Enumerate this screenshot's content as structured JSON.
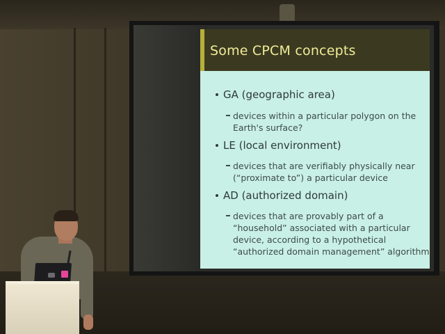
{
  "slide": {
    "title": "Some CPCM concepts",
    "colors": {
      "header_bg": "#3b3a20",
      "title_text": "#f0ec9a",
      "body_bg": "#c9f0e6",
      "body_text": "#2d3a38"
    },
    "bullets": [
      {
        "text": "GA (geographic area)",
        "sub": [
          "devices within a particular polygon on the",
          "Earth's surface?"
        ]
      },
      {
        "text": "LE (local environment)",
        "sub": [
          "devices that are verifiably physically near",
          "(“proximate to”) a particular device"
        ]
      },
      {
        "text": "AD (authorized domain)",
        "sub": [
          "devices that are provably part of a",
          "“household” associated with a particular",
          "device, according to a hypothetical",
          "“authorized domain management” algorithm"
        ]
      }
    ]
  }
}
